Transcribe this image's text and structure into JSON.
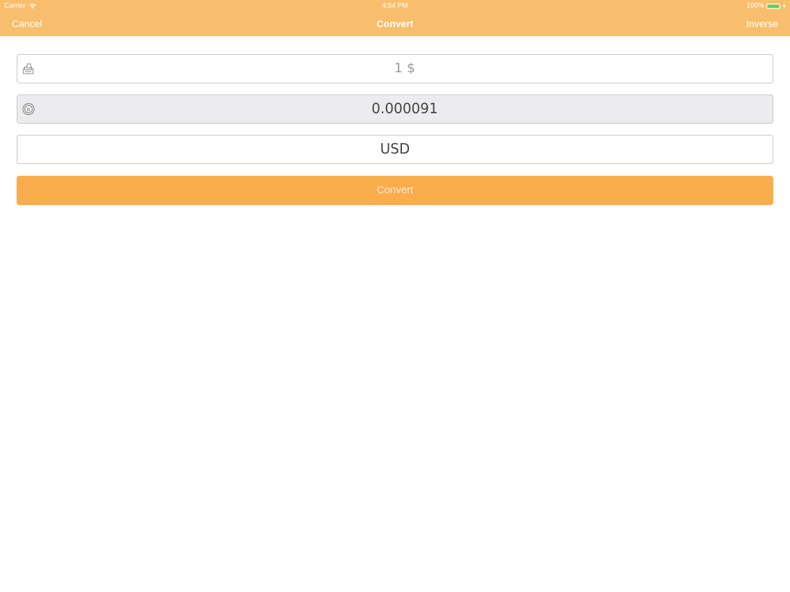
{
  "status_bar": {
    "carrier": "Carrier",
    "time": "4:54 PM",
    "battery_percent": "100%",
    "icons": [
      "wifi-icon",
      "battery-icon",
      "charging-icon"
    ]
  },
  "nav": {
    "left_label": "Cancel",
    "title": "Convert",
    "right_label": "Inverse"
  },
  "form": {
    "amount": {
      "value": "1 $",
      "icon": "cash-icon"
    },
    "result": {
      "value": "0.000091",
      "icon": "coin-icon"
    },
    "currency": {
      "value": "USD"
    },
    "convert_label": "Convert"
  },
  "colors": {
    "header": "#f9be6b",
    "button": "#f9ad4c",
    "battery": "#4cd964",
    "readonly_field": "#ececee"
  }
}
